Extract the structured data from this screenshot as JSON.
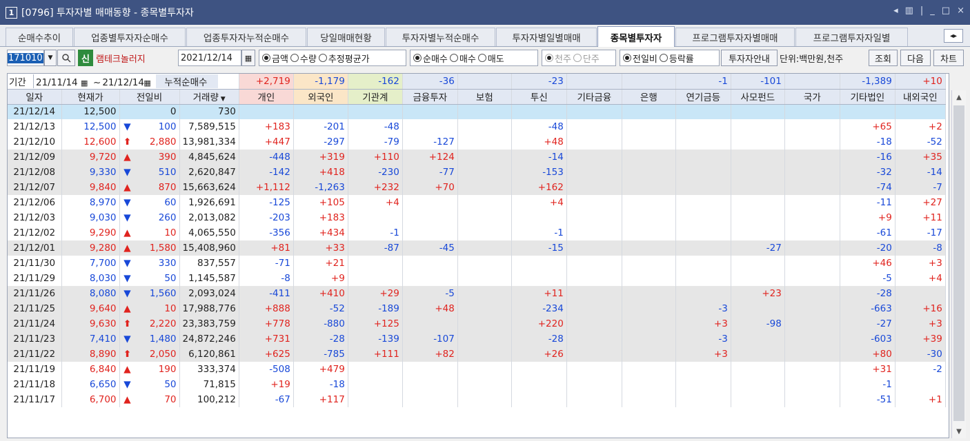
{
  "window": {
    "number": "1",
    "title": "[0796] 투자자별 매매동향 - 종목별투자자",
    "controls": [
      "◂",
      "▥",
      "|",
      "_",
      "□",
      "×"
    ]
  },
  "tabs": [
    "순매수추이",
    "업종별투자자순매수",
    "업종투자자누적순매수",
    "당일매매현황",
    "투자자별누적순매수",
    "투자자별일별매매",
    "종목별투자자",
    "프로그램투자자별매매",
    "프로그램투자자일별"
  ],
  "active_tab": 6,
  "toolbar": {
    "code": "171010",
    "sin_label": "신",
    "stock_name": "램테크놀러지",
    "date": "2021/12/14",
    "radio_amount": [
      "금액",
      "수량",
      "추정평균가"
    ],
    "radio_trade": [
      "순매수",
      "매수",
      "매도"
    ],
    "radio_unit": [
      "천주",
      "단주"
    ],
    "radio_compare": [
      "전일비",
      "등락률"
    ],
    "guide_button": "투자자안내",
    "unit_label": "단위:백만원,천주",
    "query_button": "조회",
    "next_button": "다음",
    "chart_button": "차트"
  },
  "range": {
    "label": "기간",
    "from": "21/11/14",
    "tilde": "~",
    "to": "21/12/14",
    "cum_label": "누적순매수"
  },
  "summary": [
    "+2,719",
    "-1,179",
    "-162",
    "-36",
    "",
    "-23",
    "",
    "",
    "-1",
    "-101",
    "",
    "-1,389",
    "+10"
  ],
  "columns": [
    "일자",
    "현재가",
    "전일비",
    "거래량",
    "개인",
    "외국인",
    "기관계",
    "금융투자",
    "보험",
    "투신",
    "기타금융",
    "은행",
    "연기금등",
    "사모펀드",
    "국가",
    "기타법인",
    "내외국인"
  ],
  "rows": [
    [
      "21/12/14",
      "12,500",
      "",
      "0",
      "730",
      "",
      "",
      "",
      "",
      "",
      "",
      "",
      "",
      "",
      "",
      "",
      "",
      ""
    ],
    [
      "21/12/13",
      "12,500",
      "down",
      "100",
      "7,589,515",
      "+183",
      "-201",
      "-48",
      "",
      "",
      "-48",
      "",
      "",
      "",
      "",
      "",
      "+65",
      "+2"
    ],
    [
      "21/12/10",
      "12,600",
      "up2",
      "2,880",
      "13,981,334",
      "+447",
      "-297",
      "-79",
      "-127",
      "",
      "+48",
      "",
      "",
      "",
      "",
      "",
      "-18",
      "-52"
    ],
    [
      "21/12/09",
      "9,720",
      "up",
      "390",
      "4,845,624",
      "-448",
      "+319",
      "+110",
      "+124",
      "",
      "-14",
      "",
      "",
      "",
      "",
      "",
      "-16",
      "+35"
    ],
    [
      "21/12/08",
      "9,330",
      "down",
      "510",
      "2,620,847",
      "-142",
      "+418",
      "-230",
      "-77",
      "",
      "-153",
      "",
      "",
      "",
      "",
      "",
      "-32",
      "-14"
    ],
    [
      "21/12/07",
      "9,840",
      "up",
      "870",
      "15,663,624",
      "+1,112",
      "-1,263",
      "+232",
      "+70",
      "",
      "+162",
      "",
      "",
      "",
      "",
      "",
      "-74",
      "-7"
    ],
    [
      "21/12/06",
      "8,970",
      "down",
      "60",
      "1,926,691",
      "-125",
      "+105",
      "+4",
      "",
      "",
      "+4",
      "",
      "",
      "",
      "",
      "",
      "-11",
      "+27"
    ],
    [
      "21/12/03",
      "9,030",
      "down",
      "260",
      "2,013,082",
      "-203",
      "+183",
      "",
      "",
      "",
      "",
      "",
      "",
      "",
      "",
      "",
      "+9",
      "+11"
    ],
    [
      "21/12/02",
      "9,290",
      "up",
      "10",
      "4,065,550",
      "-356",
      "+434",
      "-1",
      "",
      "",
      "-1",
      "",
      "",
      "",
      "",
      "",
      "-61",
      "-17"
    ],
    [
      "21/12/01",
      "9,280",
      "up",
      "1,580",
      "15,408,960",
      "+81",
      "+33",
      "-87",
      "-45",
      "",
      "-15",
      "",
      "",
      "",
      "-27",
      "",
      "-20",
      "-8"
    ],
    [
      "21/11/30",
      "7,700",
      "down",
      "330",
      "837,557",
      "-71",
      "+21",
      "",
      "",
      "",
      "",
      "",
      "",
      "",
      "",
      "",
      "+46",
      "+3"
    ],
    [
      "21/11/29",
      "8,030",
      "down",
      "50",
      "1,145,587",
      "-8",
      "+9",
      "",
      "",
      "",
      "",
      "",
      "",
      "",
      "",
      "",
      "-5",
      "+4"
    ],
    [
      "21/11/26",
      "8,080",
      "down",
      "1,560",
      "2,093,024",
      "-411",
      "+410",
      "+29",
      "-5",
      "",
      "+11",
      "",
      "",
      "",
      "+23",
      "",
      "-28",
      ""
    ],
    [
      "21/11/25",
      "9,640",
      "up",
      "10",
      "17,988,776",
      "+888",
      "-52",
      "-189",
      "+48",
      "",
      "-234",
      "",
      "",
      "-3",
      "",
      "",
      "-663",
      "+16"
    ],
    [
      "21/11/24",
      "9,630",
      "up2",
      "2,220",
      "23,383,759",
      "+778",
      "-880",
      "+125",
      "",
      "",
      "+220",
      "",
      "",
      "+3",
      "-98",
      "",
      "-27",
      "+3"
    ],
    [
      "21/11/23",
      "7,410",
      "down",
      "1,480",
      "24,872,246",
      "+731",
      "-28",
      "-139",
      "-107",
      "",
      "-28",
      "",
      "",
      "-3",
      "",
      "",
      "-603",
      "+39"
    ],
    [
      "21/11/22",
      "8,890",
      "up2",
      "2,050",
      "6,120,861",
      "+625",
      "-785",
      "+111",
      "+82",
      "",
      "+26",
      "",
      "",
      "+3",
      "",
      "",
      "+80",
      "-30"
    ],
    [
      "21/11/19",
      "6,840",
      "up",
      "190",
      "333,374",
      "-508",
      "+479",
      "",
      "",
      "",
      "",
      "",
      "",
      "",
      "",
      "",
      "+31",
      "-2"
    ],
    [
      "21/11/18",
      "6,650",
      "down",
      "50",
      "71,815",
      "+19",
      "-18",
      "",
      "",
      "",
      "",
      "",
      "",
      "",
      "",
      "",
      "-1",
      ""
    ],
    [
      "21/11/17",
      "6,700",
      "up",
      "70",
      "100,212",
      "-67",
      "+117",
      "",
      "",
      "",
      "",
      "",
      "",
      "",
      "",
      "",
      "-51",
      "+1"
    ]
  ],
  "colors": {
    "title_bg": "#3e5382",
    "header_bg": "#e2e8f3",
    "individual_bg": "#f9d9d6",
    "foreign_bg": "#fbe6c7",
    "inst_bg": "#e5efc9",
    "selected_row_bg": "#c9e6f7",
    "shade_row_bg": "#e6e6e6",
    "up": "#e0231e",
    "down": "#1848d8"
  }
}
